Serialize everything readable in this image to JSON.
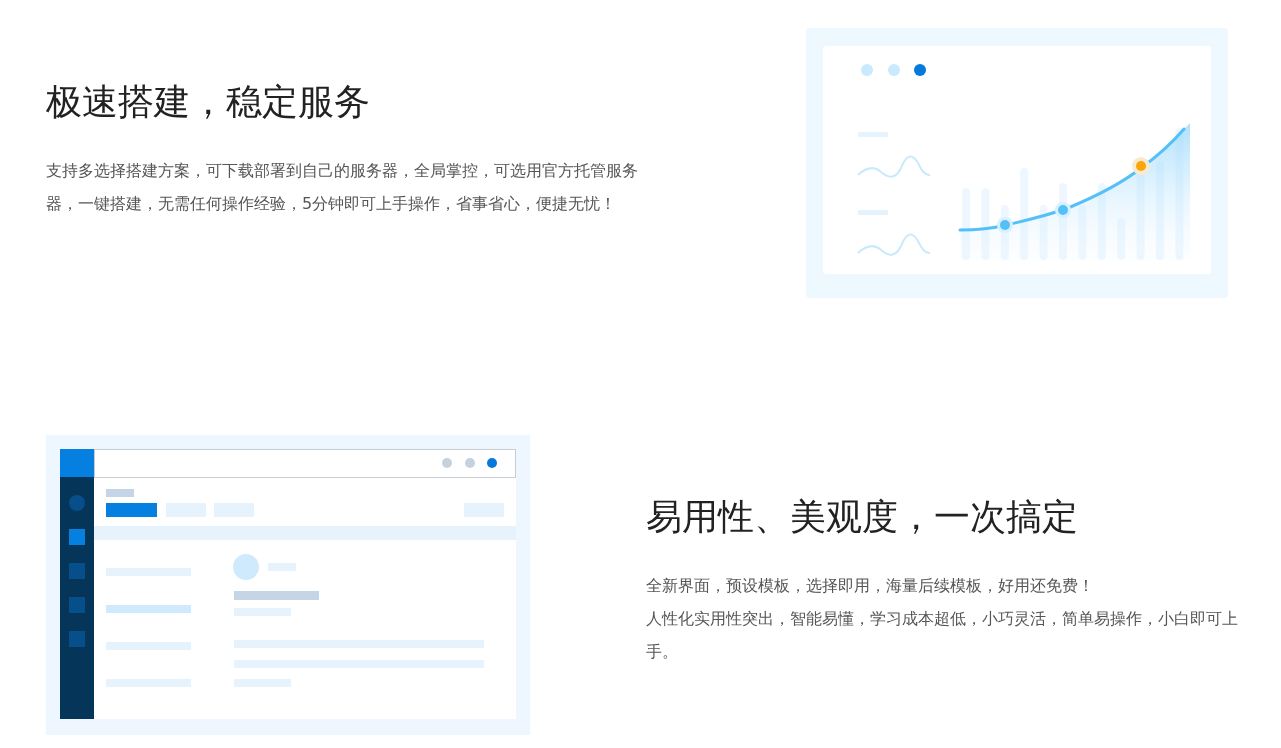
{
  "sections": [
    {
      "title": "极速搭建，稳定服务",
      "paragraphs": [
        "支持多选择搭建方案，可下载部署到自己的服务器，全局掌控，可选用官方托管服务器，一键搭建，无需任何操作经验，5分钟即可上手操作，省事省心，便捷无忧！"
      ]
    },
    {
      "title": "易用性、美观度，一次搞定",
      "paragraphs": [
        "全新界面，预设模板，选择即用，海量后续模板，好用还免费！",
        "人性化实用性突出，智能易懂，学习成本超低，小巧灵活，简单易操作，小白即可上手。"
      ]
    }
  ]
}
